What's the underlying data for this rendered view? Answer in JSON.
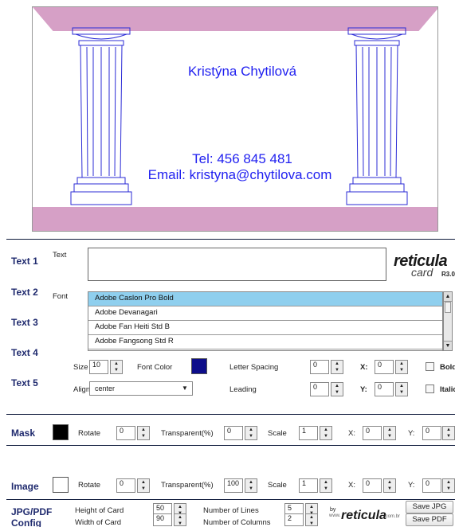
{
  "card": {
    "name": "Kristýna Chytilová",
    "tel": "Tel: 456 845 481",
    "email": "Email: kristyna@chytilova.com",
    "colors": {
      "band": "#d6a0c6",
      "text": "#1f1ff0",
      "column": "#2b2bd6"
    }
  },
  "sections": {
    "text1": "Text 1",
    "text2": "Text 2",
    "text3": "Text 3",
    "text4": "Text 4",
    "text5": "Text 5",
    "mask": "Mask",
    "image": "Image",
    "jpgpdf": "JPG/PDF",
    "config": "Config"
  },
  "text_row": {
    "text_label": "Text",
    "font_label": "Font",
    "text_value": "",
    "fonts": [
      "Adobe Caslon Pro Bold",
      "Adobe Devanagari",
      "Adobe Fan Heiti Std B",
      "Adobe Fangsong Std R"
    ],
    "selected_font_index": 0,
    "size_label": "Size",
    "size_value": "10",
    "font_color_label": "Font Color",
    "font_color": "#0d0d8a",
    "letter_spacing_label": "Letter Spacing",
    "letter_spacing_value": "0",
    "x_label": "X:",
    "x_value": "0",
    "bold_label": "Bold",
    "align_label": "Align",
    "align_value": "center",
    "leading_label": "Leading",
    "leading_value": "0",
    "y_label": "Y:",
    "y_value": "0",
    "italic_label": "Italic"
  },
  "mask_row": {
    "swatch_color": "#000000",
    "rotate_label": "Rotate",
    "rotate_value": "0",
    "transparent_label": "Transparent(%)",
    "transparent_value": "0",
    "scale_label": "Scale",
    "scale_value": "1",
    "x_label": "X:",
    "x_value": "0",
    "y_label": "Y:",
    "y_value": "0"
  },
  "image_row": {
    "swatch_color": "#ffffff",
    "rotate_label": "Rotate",
    "rotate_value": "0",
    "transparent_label": "Transparent(%)",
    "transparent_value": "100",
    "scale_label": "Scale",
    "scale_value": "1",
    "x_label": "X:",
    "x_value": "0",
    "y_label": "Y:",
    "y_value": "0"
  },
  "config_row": {
    "height_label": "Height of Card",
    "height_value": "50",
    "width_label": "Width of Card",
    "width_value": "90",
    "lines_label": "Number of Lines",
    "lines_value": "5",
    "columns_label": "Number of Columns",
    "columns_value": "2",
    "by_label": "by",
    "www_label": "www.",
    "brand": "reticula",
    "brand_suffix": ".com.br",
    "save_jpg": "Save JPG",
    "save_pdf": "Save PDF"
  },
  "logo": {
    "line1": "reticula",
    "line2": "card",
    "version": "R3.0"
  }
}
